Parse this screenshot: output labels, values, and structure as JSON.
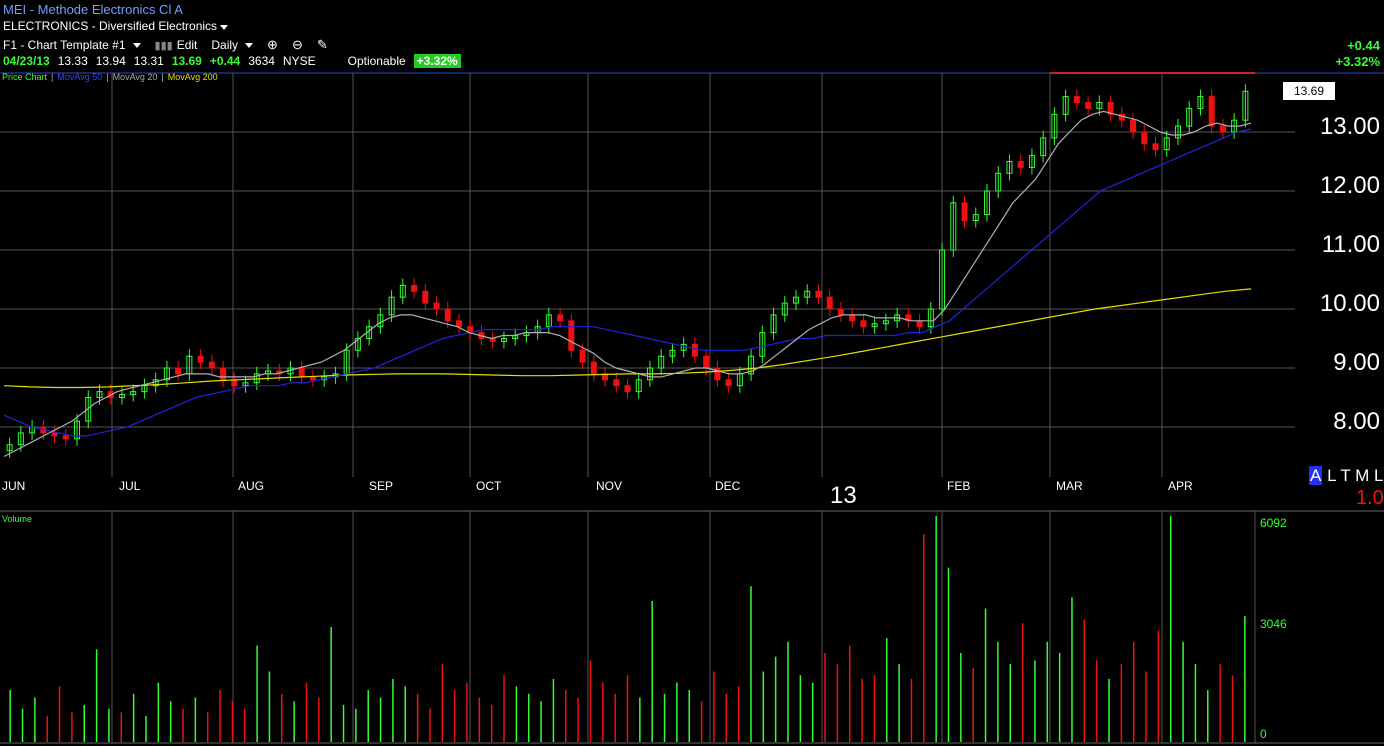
{
  "header": {
    "title": "MEI - Methode Electronics Cl A",
    "sector": "ELECTRONICS - Diversified Electronics",
    "template": "F1 - Chart Template #1",
    "edit_label": "Edit",
    "period": "Daily"
  },
  "quote": {
    "date": "04/23/13",
    "open": "13.33",
    "high": "13.94",
    "low": "13.31",
    "close": "13.69",
    "change": "+0.44",
    "volume": "3634",
    "exchange": "NYSE",
    "optionable": "Optionable",
    "pct_change": "+3.32%"
  },
  "right_change": {
    "abs": "+0.44",
    "pct": "+3.32%"
  },
  "legend": {
    "price_chart": "Price Chart",
    "ma50": "MovAvg 50",
    "ma20": "MovAvg 20",
    "ma200": "MovAvg 200"
  },
  "last_price": "13.69",
  "year_label": "13",
  "volume_panel": {
    "title": "Volume",
    "max": "6092",
    "mid": "3046",
    "zero": "0"
  },
  "corner": {
    "a": "A",
    "rest": "L T M L",
    "ratio": "1.0"
  },
  "colors": {
    "up": "#33ff33",
    "down": "#ee1111",
    "ma50": "#2222dd",
    "ma20": "#b0b0b0",
    "ma200": "#e0e000",
    "grid": "#555555"
  },
  "chart_data": {
    "type": "candlestick",
    "y_ticks": [
      "13.00",
      "12.00",
      "11.00",
      "10.00",
      "9.00",
      "8.00"
    ],
    "ylim": [
      7.0,
      14.0
    ],
    "months": [
      "JUN",
      "JUL",
      "AUG",
      "SEP",
      "OCT",
      "NOV",
      "DEC",
      "FEB",
      "MAR",
      "APR"
    ],
    "close_series": [
      7.7,
      7.9,
      8.0,
      7.9,
      7.85,
      7.8,
      8.1,
      8.5,
      8.6,
      8.5,
      8.55,
      8.6,
      8.7,
      8.8,
      9.0,
      8.9,
      9.2,
      9.1,
      9.0,
      8.8,
      8.7,
      8.75,
      8.9,
      8.95,
      8.9,
      9.0,
      8.85,
      8.8,
      8.85,
      8.9,
      9.3,
      9.5,
      9.7,
      9.9,
      10.2,
      10.4,
      10.3,
      10.1,
      10.0,
      9.8,
      9.7,
      9.6,
      9.5,
      9.45,
      9.5,
      9.55,
      9.6,
      9.7,
      9.9,
      9.8,
      9.3,
      9.1,
      8.9,
      8.8,
      8.7,
      8.6,
      8.8,
      9.0,
      9.2,
      9.3,
      9.4,
      9.2,
      9.0,
      8.8,
      8.7,
      8.9,
      9.2,
      9.6,
      9.9,
      10.1,
      10.2,
      10.3,
      10.2,
      10.0,
      9.9,
      9.8,
      9.7,
      9.75,
      9.8,
      9.9,
      9.8,
      9.7,
      10.0,
      11.0,
      11.8,
      11.5,
      11.6,
      12.0,
      12.3,
      12.5,
      12.4,
      12.6,
      12.9,
      13.3,
      13.6,
      13.5,
      13.4,
      13.5,
      13.3,
      13.2,
      13.0,
      12.8,
      12.7,
      12.9,
      13.1,
      13.4,
      13.6,
      13.1,
      13.0,
      13.2,
      13.69
    ],
    "ma20": [
      7.5,
      7.6,
      7.7,
      7.8,
      7.9,
      8.0,
      8.1,
      8.25,
      8.4,
      8.5,
      8.6,
      8.65,
      8.7,
      8.75,
      8.8,
      8.85,
      8.9,
      8.9,
      8.9,
      8.85,
      8.85,
      8.85,
      8.85,
      8.9,
      8.9,
      8.95,
      9.0,
      9.05,
      9.1,
      9.2,
      9.3,
      9.45,
      9.6,
      9.75,
      9.85,
      9.9,
      9.9,
      9.85,
      9.8,
      9.75,
      9.7,
      9.6,
      9.55,
      9.5,
      9.55,
      9.55,
      9.6,
      9.6,
      9.6,
      9.55,
      9.45,
      9.35,
      9.25,
      9.1,
      9.0,
      8.95,
      8.9,
      8.85,
      8.85,
      8.9,
      8.95,
      9.0,
      9.0,
      8.95,
      8.9,
      8.9,
      8.95,
      9.05,
      9.2,
      9.35,
      9.5,
      9.65,
      9.75,
      9.85,
      9.9,
      9.9,
      9.9,
      9.85,
      9.85,
      9.85,
      9.8,
      9.8,
      9.8,
      10.0,
      10.3,
      10.6,
      10.9,
      11.2,
      11.5,
      11.8,
      12.0,
      12.2,
      12.5,
      12.8,
      13.0,
      13.2,
      13.3,
      13.35,
      13.3,
      13.25,
      13.2,
      13.1,
      13.0,
      12.95,
      12.95,
      13.0,
      13.1,
      13.15,
      13.1,
      13.1,
      13.15
    ],
    "ma50": [
      8.2,
      8.1,
      8.0,
      7.95,
      7.9,
      7.85,
      7.85,
      7.9,
      7.95,
      8.0,
      8.1,
      8.2,
      8.3,
      8.4,
      8.5,
      8.55,
      8.6,
      8.65,
      8.7,
      8.7,
      8.7,
      8.75,
      8.75,
      8.8,
      8.85,
      8.9,
      8.95,
      9.0,
      9.1,
      9.2,
      9.3,
      9.4,
      9.5,
      9.55,
      9.6,
      9.65,
      9.65,
      9.65,
      9.65,
      9.65,
      9.7,
      9.7,
      9.7,
      9.7,
      9.65,
      9.6,
      9.55,
      9.5,
      9.45,
      9.4,
      9.35,
      9.3,
      9.3,
      9.3,
      9.3,
      9.35,
      9.4,
      9.45,
      9.5,
      9.5,
      9.55,
      9.55,
      9.55,
      9.55,
      9.55,
      9.55,
      9.6,
      9.6,
      9.7,
      9.8,
      10.0,
      10.2,
      10.4,
      10.6,
      10.8,
      11.0,
      11.2,
      11.4,
      11.6,
      11.8,
      12.0,
      12.1,
      12.2,
      12.3,
      12.4,
      12.5,
      12.6,
      12.7,
      12.8,
      12.9,
      13.0,
      13.05
    ],
    "ma200": [
      8.7,
      8.68,
      8.67,
      8.67,
      8.68,
      8.7,
      8.72,
      8.75,
      8.78,
      8.8,
      8.82,
      8.84,
      8.86,
      8.88,
      8.89,
      8.9,
      8.9,
      8.9,
      8.89,
      8.88,
      8.87,
      8.87,
      8.88,
      8.89,
      8.9,
      8.9,
      8.91,
      8.93,
      8.96,
      9.0,
      9.06,
      9.13,
      9.2,
      9.28,
      9.36,
      9.44,
      9.52,
      9.6,
      9.68,
      9.76,
      9.84,
      9.92,
      10.0,
      10.06,
      10.12,
      10.18,
      10.24,
      10.3,
      10.34
    ],
    "volume": [
      1400,
      900,
      1200,
      700,
      1500,
      800,
      1000,
      2500,
      900,
      800,
      1300,
      700,
      1600,
      1100,
      900,
      1200,
      800,
      1400,
      1100,
      900,
      2600,
      1900,
      1300,
      1100,
      1600,
      1200,
      3100,
      1000,
      900,
      1400,
      1200,
      1700,
      1500,
      1300,
      900,
      2100,
      1400,
      1600,
      1200,
      1000,
      1800,
      1500,
      1300,
      1100,
      1700,
      1400,
      1200,
      2200,
      1600,
      1300,
      1800,
      1200,
      3800,
      1300,
      1600,
      1400,
      1100,
      1900,
      1300,
      1500,
      4200,
      1900,
      2300,
      2700,
      1800,
      1600,
      2400,
      2100,
      2600,
      1700,
      1800,
      2800,
      2100,
      1700,
      5600,
      6092,
      4700,
      2400,
      2000,
      3600,
      2700,
      2100,
      3200,
      2200,
      2700,
      2400,
      3900,
      3300,
      2200,
      1700,
      2100,
      2700,
      1900,
      3000,
      6092,
      2700,
      2100,
      1400,
      2100,
      1800,
      3400
    ]
  }
}
